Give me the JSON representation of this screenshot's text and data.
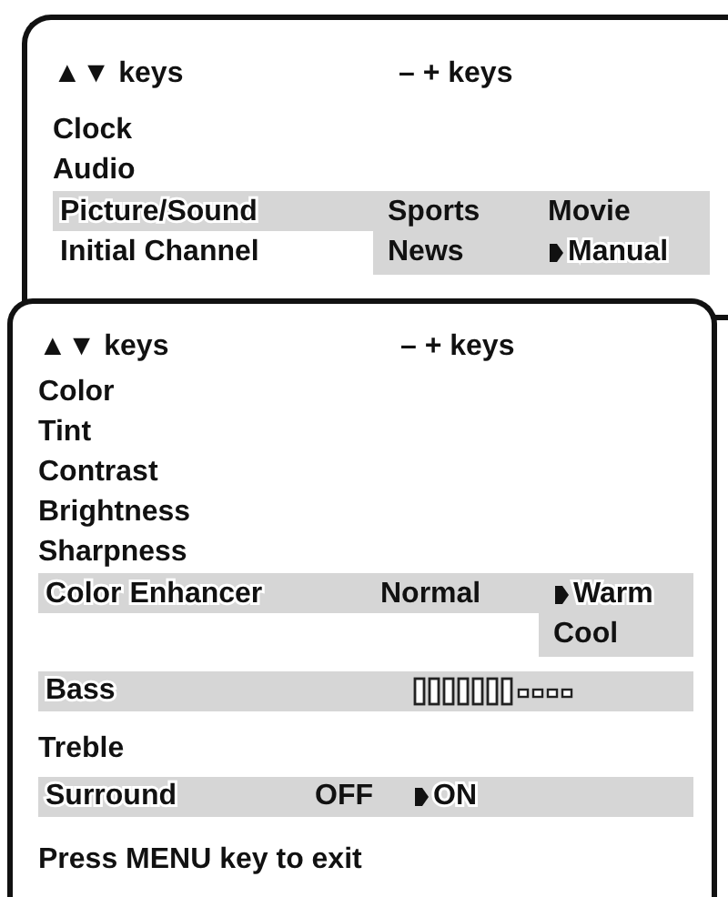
{
  "menus": [
    {
      "headers": [
        "▲▼ keys",
        "– + keys"
      ],
      "rows": [
        {
          "kind": "plain",
          "label": "Clock",
          "selected": false
        },
        {
          "kind": "plain",
          "label": "Audio",
          "selected": false
        },
        {
          "kind": "choice",
          "label": "Picture/Sound",
          "selected": true,
          "options": [
            {
              "text": "Sports",
              "selected": false
            },
            {
              "text": "Movie",
              "selected": false
            }
          ]
        },
        {
          "kind": "choice",
          "label": "Initial Channel",
          "selected": false,
          "options": [
            {
              "text": "News",
              "selected": false,
              "highlighted": true
            },
            {
              "text": "Manual",
              "selected": true,
              "highlighted": true
            }
          ]
        }
      ]
    },
    {
      "headers": [
        "▲▼ keys",
        "– + keys"
      ],
      "rows": [
        {
          "kind": "plain",
          "label": "Color",
          "selected": false
        },
        {
          "kind": "plain",
          "label": "Tint",
          "selected": false
        },
        {
          "kind": "plain",
          "label": "Contrast",
          "selected": false
        },
        {
          "kind": "plain",
          "label": "Brightness",
          "selected": false
        },
        {
          "kind": "plain",
          "label": "Sharpness",
          "selected": false
        },
        {
          "kind": "choice",
          "label": "Color Enhancer",
          "selected": true,
          "options": [
            {
              "text": "Normal",
              "selected": false
            },
            {
              "text": "Warm",
              "selected": true
            }
          ]
        },
        {
          "kind": "choice",
          "selected": false,
          "options": [
            {
              "text": "Cool",
              "selected": false,
              "highlighted": true
            }
          ]
        },
        {
          "kind": "level",
          "label": "Bass",
          "selected": true,
          "level": 0.636
        },
        {
          "kind": "plain",
          "label": "Treble",
          "selected": false
        },
        {
          "kind": "toggle",
          "label": "Surround",
          "selected": true,
          "options": [
            {
              "text": "OFF",
              "selected": false
            },
            {
              "text": "ON",
              "selected": true
            }
          ]
        }
      ],
      "footer": "Press MENU key to exit"
    }
  ]
}
